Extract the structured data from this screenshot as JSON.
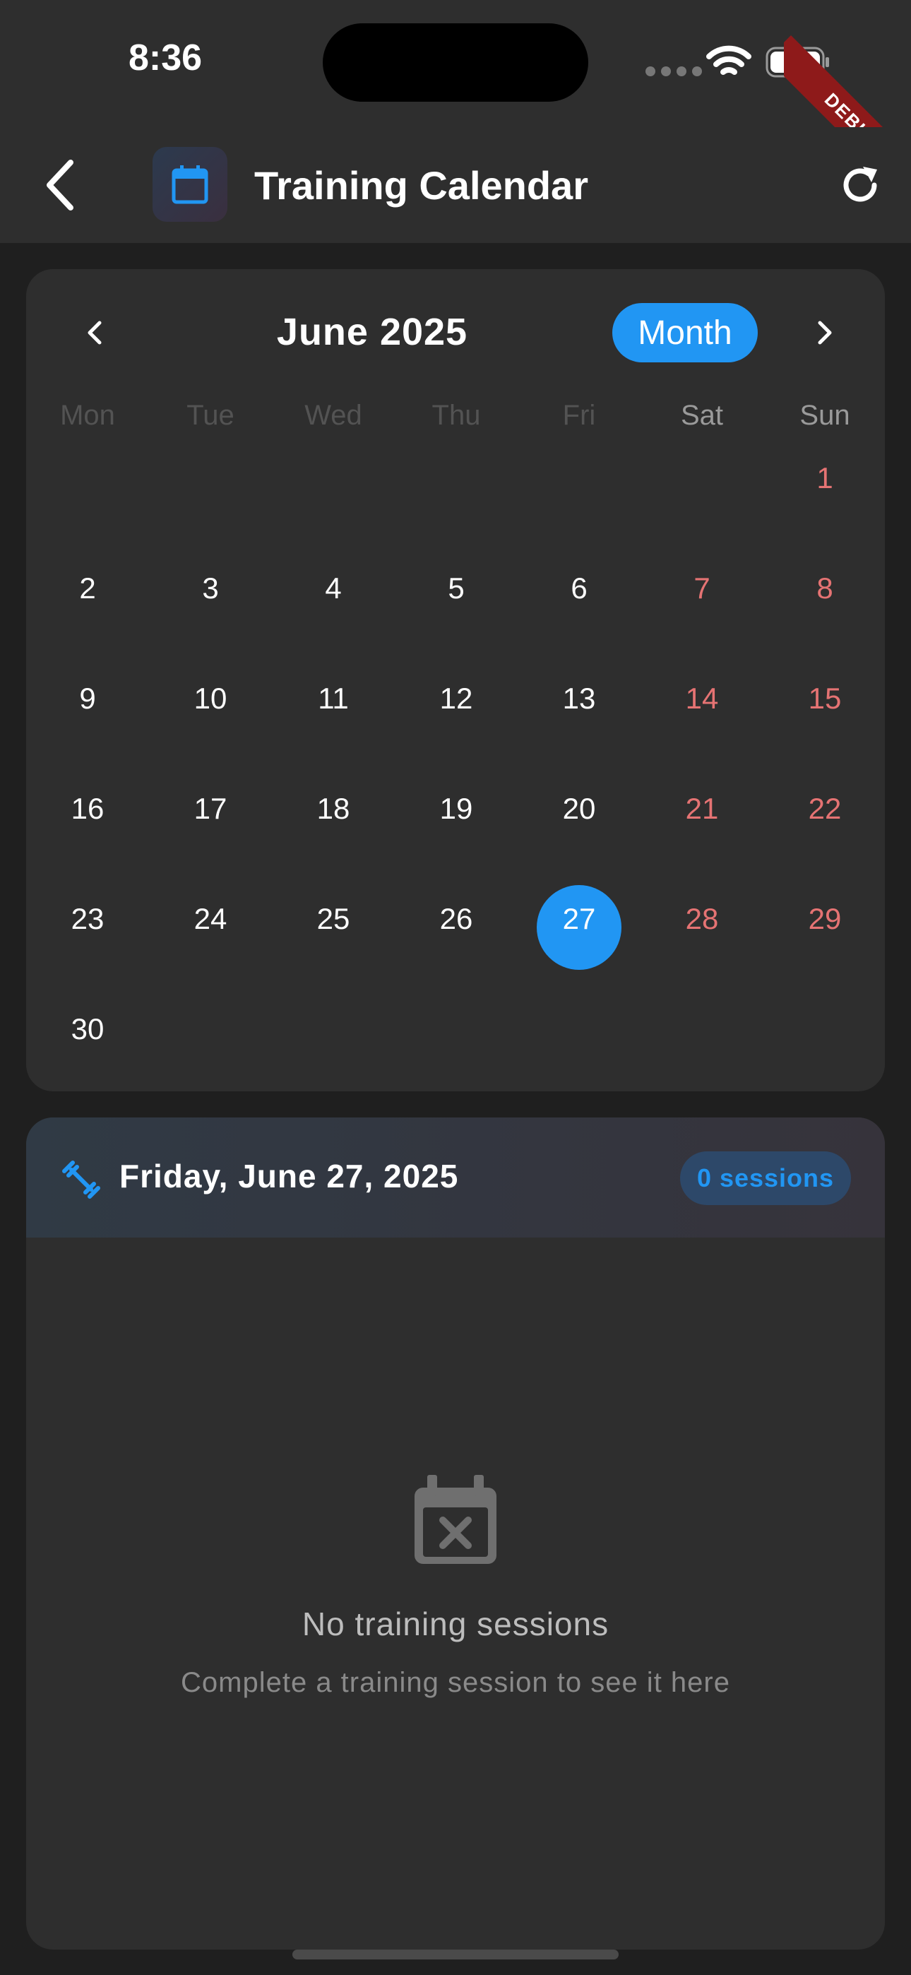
{
  "status": {
    "time": "8:36"
  },
  "debug_label": "DEBUG",
  "header": {
    "title": "Training Calendar"
  },
  "calendar": {
    "month_title": "June 2025",
    "view_button": "Month",
    "weekdays": [
      "Mon",
      "Tue",
      "Wed",
      "Thu",
      "Fri",
      "Sat",
      "Sun"
    ],
    "selected_day": "27",
    "weeks": [
      [
        "",
        "",
        "",
        "",
        "",
        "",
        "1"
      ],
      [
        "2",
        "3",
        "4",
        "5",
        "6",
        "7",
        "8"
      ],
      [
        "9",
        "10",
        "11",
        "12",
        "13",
        "14",
        "15"
      ],
      [
        "16",
        "17",
        "18",
        "19",
        "20",
        "21",
        "22"
      ],
      [
        "23",
        "24",
        "25",
        "26",
        "27",
        "28",
        "29"
      ],
      [
        "30",
        "",
        "",
        "",
        "",
        "",
        ""
      ]
    ]
  },
  "sessions": {
    "date": "Friday, June 27, 2025",
    "badge": "0 sessions",
    "empty_title": "No training sessions",
    "empty_subtitle": "Complete a training session to see it here"
  },
  "colors": {
    "accent": "#2196f3",
    "weekend": "#e57373",
    "card": "#2e2e2e",
    "background": "#1f1f1f"
  },
  "icons": [
    "back-arrow-icon",
    "calendar-icon",
    "refresh-icon",
    "chevron-left-icon",
    "chevron-right-icon",
    "dumbbell-icon",
    "calendar-x-icon"
  ]
}
